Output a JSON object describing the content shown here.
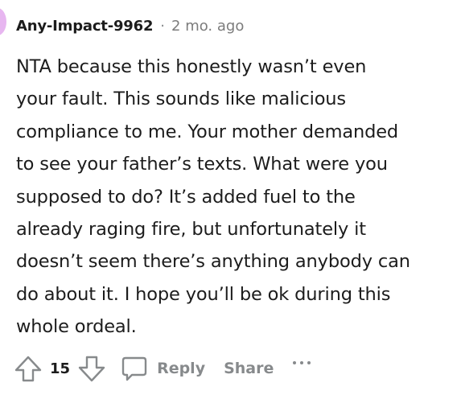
{
  "comment": {
    "author": "Any-Impact-9962",
    "separator": "·",
    "timestamp": "2 mo. ago",
    "lines": [
      "NTA because this honestly wasn’t even",
      "your fault. This sounds like malicious",
      "compliance to me. Your mother demanded",
      "to see your father’s texts. What were you",
      "supposed to do? It’s added fuel to the",
      "already raging fire, but unfortunately it",
      "doesn’t seem there’s anything anybody can",
      "do about it. I hope you’ll be ok during this",
      "whole ordeal."
    ]
  },
  "actions": {
    "upvote_icon": "upvote-arrow-icon",
    "vote_count": "15",
    "downvote_icon": "downvote-arrow-icon",
    "reply_icon": "comment-bubble-icon",
    "reply_label": "Reply",
    "share_label": "Share",
    "more_icon": "more-options-icon"
  },
  "colors": {
    "text": "#1c1c1c",
    "muted": "#878a8c",
    "avatar": "#e7b6f0"
  }
}
